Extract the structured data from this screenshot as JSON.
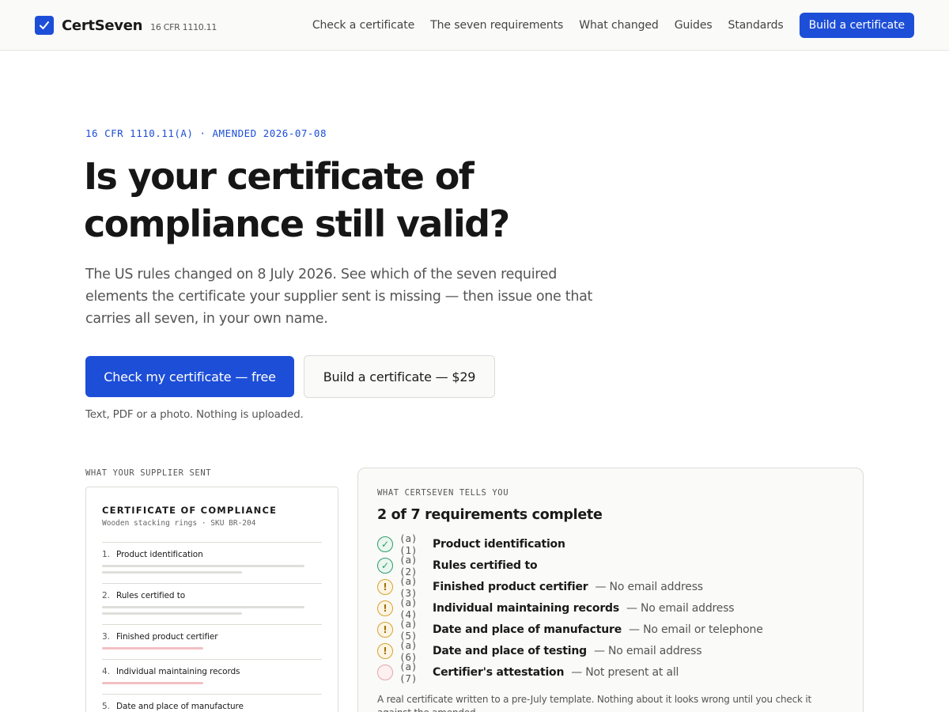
{
  "header": {
    "brand": "CertSeven",
    "brand_tag": "16 CFR 1110.11",
    "nav": [
      "Check a certificate",
      "The seven requirements",
      "What changed",
      "Guides",
      "Standards"
    ],
    "cta": "Build a certificate"
  },
  "hero": {
    "kicker": "16 CFR 1110.11(A) · AMENDED 2026-07-08",
    "headline": "Is your certificate of compliance still valid?",
    "lede": "The US rules changed on 8 July 2026. See which of the seven required elements the certificate your supplier sent is missing — then issue one that carries all seven, in your own name.",
    "primary_button": "Check my certificate — free",
    "secondary_button": "Build a certificate — $29",
    "hint": "Text, PDF or a photo. Nothing is uploaded."
  },
  "supplier": {
    "label": "WHAT YOUR SUPPLIER SENT",
    "doc_title": "CERTIFICATE OF COMPLIANCE",
    "doc_subtitle": "Wooden stacking rings · SKU BR-204",
    "items": [
      {
        "num": "1.",
        "label": "Product identification",
        "state": "ok"
      },
      {
        "num": "2.",
        "label": "Rules certified to",
        "state": "ok"
      },
      {
        "num": "3.",
        "label": "Finished product certifier",
        "state": "bad"
      },
      {
        "num": "4.",
        "label": "Individual maintaining records",
        "state": "bad"
      },
      {
        "num": "5.",
        "label": "Date and place of manufacture",
        "state": "bad"
      }
    ]
  },
  "result": {
    "label": "WHAT CERTSEVEN TELLS YOU",
    "title": "2 of 7 requirements complete",
    "requirements": [
      {
        "code": "(a)(1)",
        "name": "Product identification",
        "note": "",
        "status": "ok",
        "glyph": "✓"
      },
      {
        "code": "(a)(2)",
        "name": "Rules certified to",
        "note": "",
        "status": "ok",
        "glyph": "✓"
      },
      {
        "code": "(a)(3)",
        "name": "Finished product certifier",
        "note": "— No email address",
        "status": "warn",
        "glyph": "!"
      },
      {
        "code": "(a)(4)",
        "name": "Individual maintaining records",
        "note": "— No email address",
        "status": "warn",
        "glyph": "!"
      },
      {
        "code": "(a)(5)",
        "name": "Date and place of manufacture",
        "note": "— No email or telephone",
        "status": "warn",
        "glyph": "!"
      },
      {
        "code": "(a)(6)",
        "name": "Date and place of testing",
        "note": "— No email address",
        "status": "warn",
        "glyph": "!"
      },
      {
        "code": "(a)(7)",
        "name": "Certifier's attestation",
        "note": "— Not present at all",
        "status": "miss",
        "glyph": ""
      }
    ],
    "footnote": "A real certificate written to a pre-July template. Nothing about it looks wrong until you check it against the amended"
  },
  "colors": {
    "accent": "#1d4ed8",
    "ok": "#2e9e6a",
    "warn": "#d8a233",
    "missing": "#e4a5ab"
  },
  "icons": {
    "brand": "check-badge-icon",
    "ok": "check-icon",
    "warn": "exclamation-icon",
    "missing": "empty-circle-icon"
  }
}
